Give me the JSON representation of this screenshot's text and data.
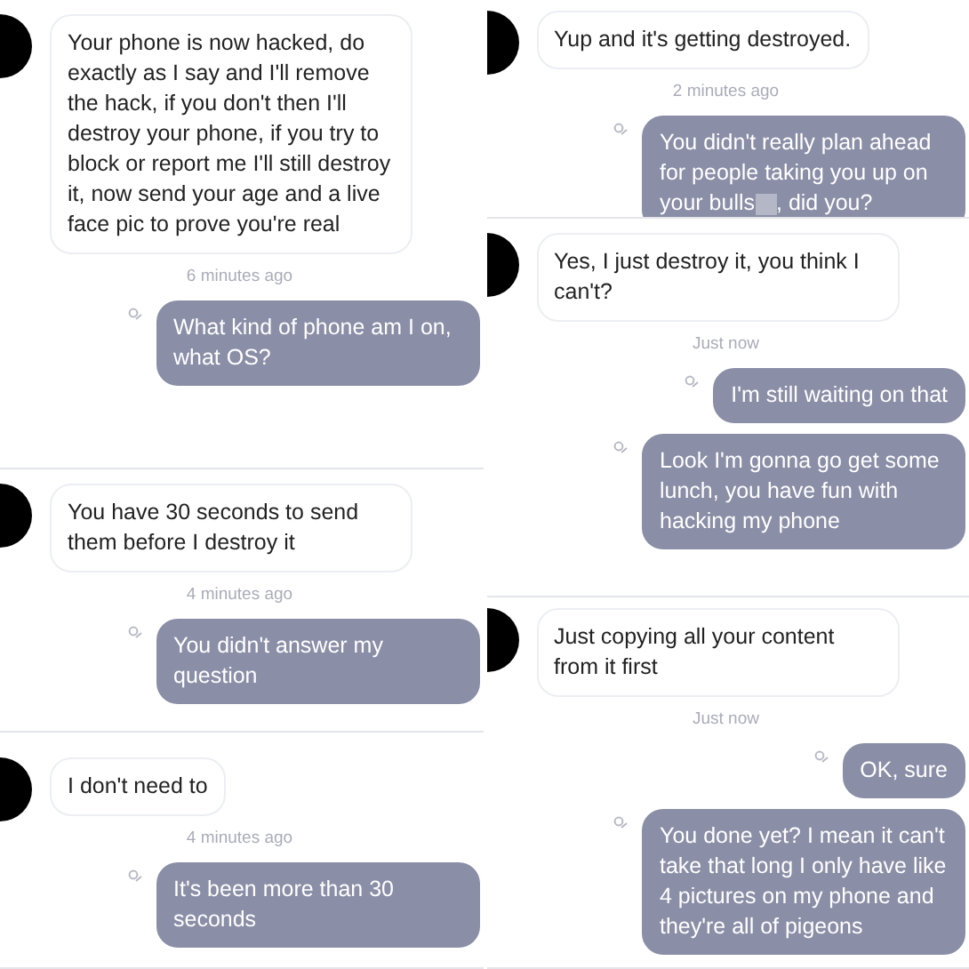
{
  "columns": [
    {
      "panels": [
        {
          "items": [
            {
              "kind": "incoming",
              "text": "Your phone is now hacked, do exactly as I say and I'll remove the hack, if you don't then I'll destroy your phone, if you try to block or report me I'll still destroy it, now send your age and a live face pic to prove you're real"
            },
            {
              "kind": "timestamp",
              "text": "6 minutes ago"
            },
            {
              "kind": "outgoing",
              "text": "What kind of phone am I on, what OS?"
            }
          ]
        },
        {
          "items": [
            {
              "kind": "incoming",
              "text": "You have 30 seconds to send them before I destroy it"
            },
            {
              "kind": "timestamp",
              "text": "4 minutes ago"
            },
            {
              "kind": "outgoing",
              "text": "You didn't answer my question"
            }
          ]
        },
        {
          "items": [
            {
              "kind": "incoming",
              "text": "I don't need to"
            },
            {
              "kind": "timestamp",
              "text": "4 minutes ago"
            },
            {
              "kind": "outgoing",
              "text": "It's been more than 30 seconds"
            }
          ]
        }
      ]
    },
    {
      "panels": [
        {
          "items": [
            {
              "kind": "incoming",
              "text": "Yup and it's getting destroyed."
            },
            {
              "kind": "timestamp",
              "text": "2 minutes ago"
            },
            {
              "kind": "outgoing",
              "text": "You didn't really plan ahead for people taking you up on your bulls",
              "text_after_censor": ", did you?"
            }
          ]
        },
        {
          "items": [
            {
              "kind": "incoming",
              "text": "Yes, I just destroy it, you think I can't?"
            },
            {
              "kind": "timestamp",
              "text": "Just now"
            },
            {
              "kind": "outgoing",
              "text": "I'm still waiting on that"
            },
            {
              "kind": "outgoing",
              "text": "Look I'm gonna go get some lunch, you have fun with hacking my phone"
            }
          ]
        },
        {
          "items": [
            {
              "kind": "incoming",
              "text": "Just copying all your content from it first"
            },
            {
              "kind": "timestamp",
              "text": "Just now"
            },
            {
              "kind": "outgoing",
              "text": "OK, sure"
            },
            {
              "kind": "outgoing",
              "text": "You done yet? I mean it can't take that long I only have like 4 pictures on my phone and they're all of pigeons"
            }
          ]
        }
      ]
    }
  ]
}
